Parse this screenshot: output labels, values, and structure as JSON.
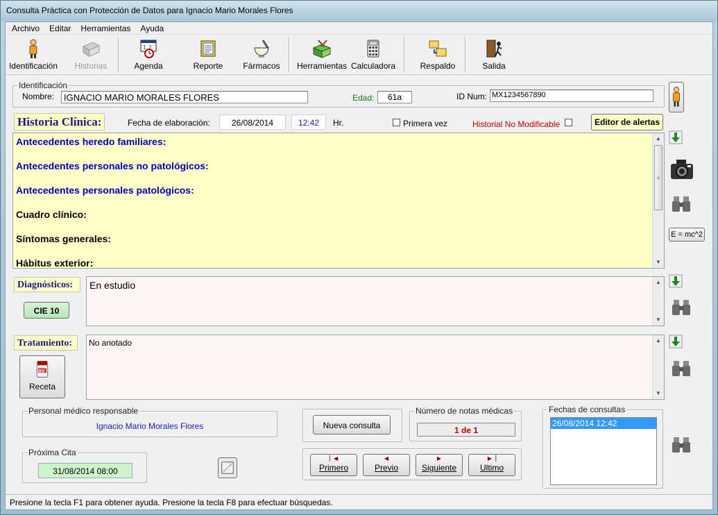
{
  "window": {
    "title": "Consulta Práctica con Protección de Datos para Ignacio Mario Morales Flores"
  },
  "menu": [
    "Archivo",
    "Editar",
    "Herramientas",
    "Ayuda"
  ],
  "toolbar": {
    "identificacion": "Identificación",
    "historias": "Historias",
    "agenda": "Agenda",
    "reporte": "Reporte",
    "farmacos": "Fármacos",
    "herramientas": "Herramientas",
    "calculadora": "Calculadora",
    "respaldo": "Respaldo",
    "salida": "Salida"
  },
  "identificacion": {
    "legend": "Identificación",
    "nombre_label": "Nombre:",
    "nombre": "IGNACIO MARIO MORALES FLORES",
    "edad_label": "Edad:",
    "edad": "61a",
    "id_label": "ID Num:",
    "id": "MX1234567890"
  },
  "historia": {
    "label": "Historia Clínica:",
    "fecha_label": "Fecha de elaboración:",
    "fecha": "26/08/2014",
    "hora": "12:42",
    "hr": "Hr.",
    "primera_vez": "Primera vez",
    "no_modificable": "Historial No Modificable",
    "editor_alertas": "Editor de alertas",
    "lines": [
      "Antecedentes heredo familiares:",
      "Antecedentes personales no patológicos:",
      "Antecedentes personales patológicos:",
      "Cuadro clínico:",
      "Síntomas generales:",
      "Hábitus exterior:"
    ]
  },
  "diagnosticos": {
    "label": "Diagnósticos:",
    "cie": "CIE 10",
    "text": "En estudio"
  },
  "tratamiento": {
    "label": "Tratamiento:",
    "receta": "Receta",
    "text": "No anotado"
  },
  "formula": "E = mc^2",
  "personal": {
    "legend": "Personal médico responsable",
    "name": "Ignacio Mario Morales Flores"
  },
  "proxima": {
    "legend": "Próxima Cita",
    "value": "31/08/2014 08:00"
  },
  "nueva_consulta": "Nueva consulta",
  "notas": {
    "legend": "Número de notas médicas",
    "value": "1 de 1"
  },
  "fechas": {
    "legend": "Fechas de consultas",
    "items": [
      "26/08/2014 12:42"
    ]
  },
  "nav": {
    "primero": "Primero",
    "previo": "Previo",
    "siguiente": "Siguiente",
    "ultimo": "Ultimo"
  },
  "status": "Presione la tecla F1 para obtener ayuda. Presione la tecla F8 para efectuar búsquedas.",
  "colors": {
    "history_bg": "#ffffc8",
    "blue_heading": "#0000c8",
    "notes_bg": "#fff5f5",
    "date_green": "#ccf5cc",
    "alert_red": "#d00000"
  }
}
